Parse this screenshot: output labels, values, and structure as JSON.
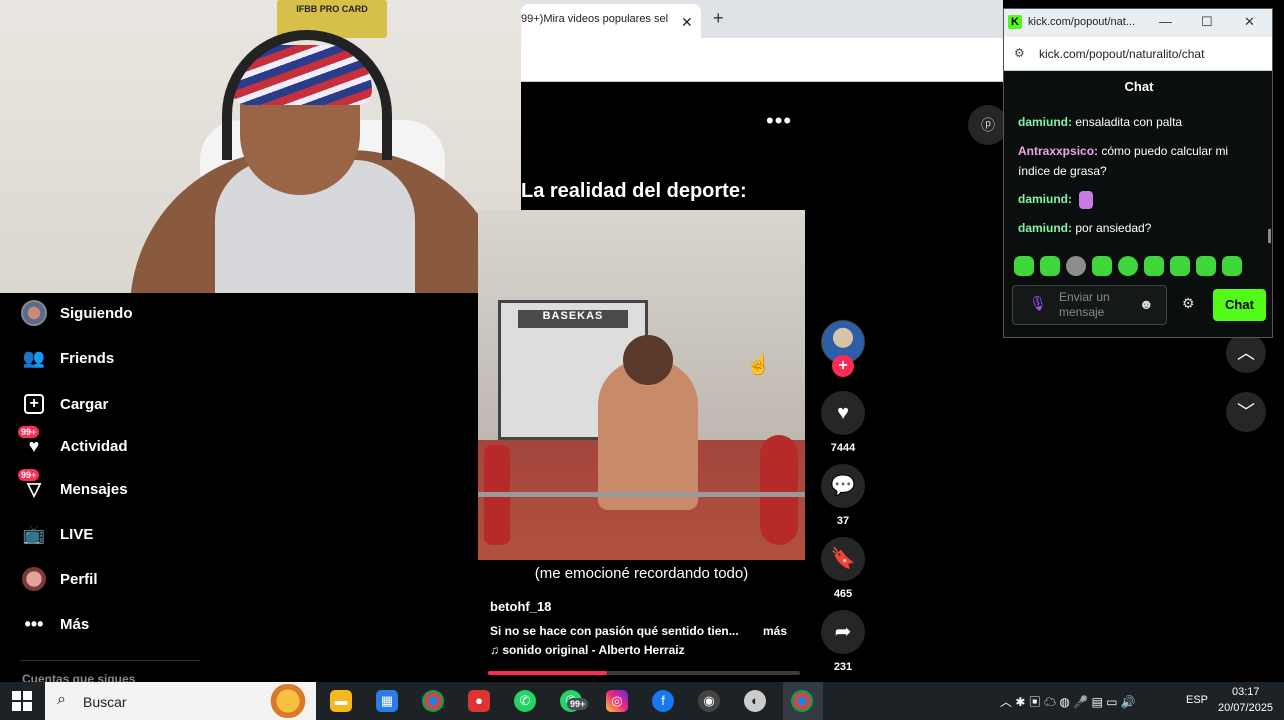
{
  "browser": {
    "tab_title": "99+)Mira videos populares sel",
    "tab_close": "✕",
    "new_tab": "+"
  },
  "webcam": {
    "sign_text": "IFBB PRO CARD"
  },
  "video": {
    "menu_dots": "•••",
    "overlay_title": "La realidad del deporte:",
    "gym_sign": "BASEKAS",
    "caption": "(me emocioné recordando todo)",
    "author": "betohf_18",
    "description": "Si no se hace con pasión qué sentido tien...",
    "more_label": "más",
    "music": "♫  sonido original - Alberto Herraiz",
    "progress": 0.38
  },
  "actions": {
    "follow": "+",
    "likes": "7444",
    "comments": "37",
    "saves": "465",
    "shares": "231"
  },
  "nav": {
    "items": [
      {
        "label": "Siguiendo",
        "icon": "avatar-icon"
      },
      {
        "label": "Friends",
        "icon": "friends-icon"
      },
      {
        "label": "Cargar",
        "icon": "upload-icon"
      },
      {
        "label": "Actividad",
        "icon": "activity-icon",
        "badge": "99+"
      },
      {
        "label": "Mensajes",
        "icon": "messages-icon",
        "badge": "99+"
      },
      {
        "label": "LIVE",
        "icon": "live-icon"
      },
      {
        "label": "Perfil",
        "icon": "profile-icon"
      },
      {
        "label": "Más",
        "icon": "more-icon"
      }
    ],
    "following_accounts_label": "Cuentas que sigues"
  },
  "kick": {
    "window_title": "kick.com/popout/nat...",
    "url": "kick.com/popout/naturalito/chat",
    "chat_title": "Chat",
    "messages": [
      {
        "user": "damiund",
        "text": "ensaladita con palta"
      },
      {
        "user": "Antraxxpsico",
        "text": "cómo puedo calcular mi índice de grasa?"
      },
      {
        "user": "damiund",
        "text": ""
      },
      {
        "user": "damiund",
        "text": "por ansiedad?"
      }
    ],
    "input_placeholder": "Enviar un mensaje",
    "send_label": "Chat"
  },
  "taskbar": {
    "search_placeholder": "Buscar",
    "badge": "99+",
    "lang": "ESP",
    "time": "03:17",
    "date": "20/07/2025"
  },
  "colors": {
    "tiktok_red": "#fe2c55",
    "kick_green": "#53fc18"
  }
}
